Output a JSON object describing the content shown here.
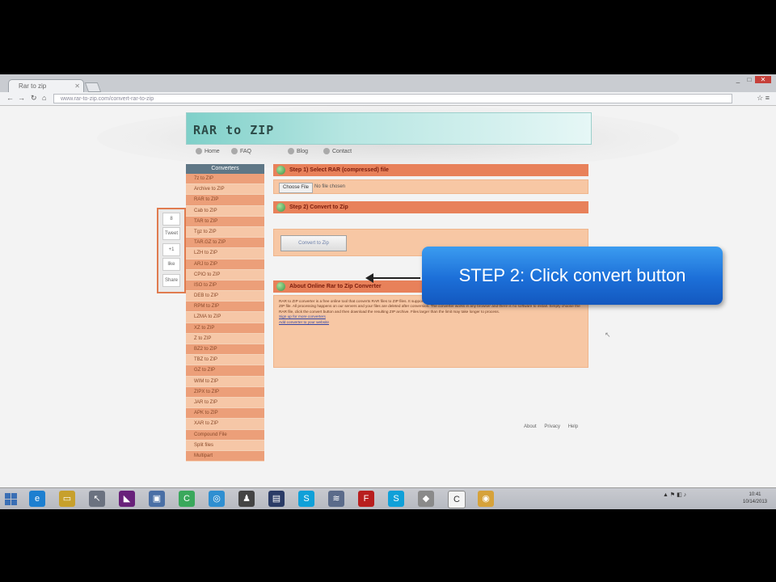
{
  "browser": {
    "tab_title": "Rar to zip",
    "url": "www.rar-to-zip.com/convert-rar-to-zip",
    "window_controls": [
      "_",
      "□",
      "✕"
    ]
  },
  "site": {
    "logo": "RAR to ZIP",
    "nav": [
      "Home",
      "FAQ",
      "Blog",
      "Contact"
    ]
  },
  "sidebar": {
    "header": "Converters",
    "items": [
      "7z to ZIP",
      "Archive to ZIP",
      "RAR to ZIP",
      "Cab to ZIP",
      "TAR to ZIP",
      "Tgz to ZIP",
      "TAR.GZ to ZIP",
      "LZH to ZIP",
      "ARJ to ZIP",
      "CPIO to ZIP",
      "ISO to ZIP",
      "DEB to ZIP",
      "RPM to ZIP",
      "LZMA to ZIP",
      "XZ to ZIP",
      "Z to ZIP",
      "BZ2 to ZIP",
      "TBZ to ZIP",
      "GZ to ZIP",
      "WIM to ZIP",
      "ZIPX to ZIP",
      "JAR to ZIP",
      "APK to ZIP",
      "XAR to ZIP",
      "Compound File",
      "Split files",
      "Multipart"
    ]
  },
  "float_panel": [
    "8",
    "Tweet",
    "+1",
    "like",
    "Share"
  ],
  "main": {
    "step1_title": "Step 1) Select RAR (compressed) file",
    "choose_file": "Choose File",
    "no_file": "No file chosen",
    "step2_title": "Step 2) Convert to Zip",
    "convert_button": "Convert to Zip",
    "about_title": "About Online Rar to Zip Converter",
    "about_text": "RAR to ZIP converter is a free online tool that converts RAR files to ZIP files. It supports RAR archives of any size. Once the conversion is complete you will be able to download the ZIP file. All processing happens on our servers and your files are deleted after conversion. The converter works in any browser and there is no software to install. Simply choose the RAR file, click the convert button and then download the resulting ZIP archive. Files larger than the limit may take longer to process.",
    "links": [
      "Sign up for more converters",
      "Add converter to your website"
    ]
  },
  "footer": [
    "About",
    "Privacy",
    "Help"
  ],
  "callout": "STEP 2: Click convert button",
  "taskbar": {
    "time": "10:41",
    "date": "10/14/2013",
    "apps": [
      {
        "icon": "ie-icon",
        "color": "#1d7fd0",
        "glyph": "e"
      },
      {
        "icon": "folder-icon",
        "color": "#c7a02c",
        "glyph": "▭"
      },
      {
        "icon": "tool-icon",
        "color": "#6b7280",
        "glyph": "↖"
      },
      {
        "icon": "visual-studio-icon",
        "color": "#68217a",
        "glyph": "◣"
      },
      {
        "icon": "network-icon",
        "color": "#4a6fa5",
        "glyph": "▣"
      },
      {
        "icon": "c-app-icon",
        "color": "#3aa85c",
        "glyph": "C"
      },
      {
        "icon": "globe-icon",
        "color": "#2f8fd1",
        "glyph": "◎"
      },
      {
        "icon": "penguin-icon",
        "color": "#444",
        "glyph": "♟"
      },
      {
        "icon": "terminal-icon",
        "color": "#2a3b66",
        "glyph": "▤"
      },
      {
        "icon": "skype-icon",
        "color": "#10a0d8",
        "glyph": "S"
      },
      {
        "icon": "tools-icon",
        "color": "#5b6b8a",
        "glyph": "≋"
      },
      {
        "icon": "filezilla-icon",
        "color": "#b81e1e",
        "glyph": "F"
      },
      {
        "icon": "skype2-icon",
        "color": "#10a0d8",
        "glyph": "S"
      },
      {
        "icon": "disk-icon",
        "color": "#8a8a8a",
        "glyph": "◆"
      },
      {
        "icon": "c-editor-icon",
        "color": "#f4f4f4",
        "glyph": "C"
      },
      {
        "icon": "chrome-icon",
        "color": "#d6a23a",
        "glyph": "◉"
      }
    ]
  }
}
